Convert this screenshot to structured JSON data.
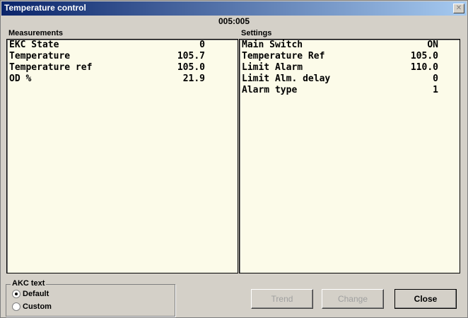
{
  "window": {
    "title": "Temperature control",
    "close_glyph": "✕"
  },
  "node_id": "005:005",
  "measurements": {
    "label": "Measurements",
    "rows": [
      {
        "name": "EKC State",
        "value": "0"
      },
      {
        "name": "Temperature",
        "value": "105.7"
      },
      {
        "name": "Temperature ref",
        "value": "105.0"
      },
      {
        "name": "OD %",
        "value": "21.9"
      }
    ]
  },
  "settings": {
    "label": "Settings",
    "rows": [
      {
        "name": "Main Switch",
        "value": "ON"
      },
      {
        "name": "Temperature Ref",
        "value": "105.0"
      },
      {
        "name": "Limit Alarm",
        "value": "110.0"
      },
      {
        "name": "Limit Alm. delay",
        "value": "0"
      },
      {
        "name": "Alarm type",
        "value": "1"
      }
    ]
  },
  "akc_text": {
    "label": "AKC text",
    "options": [
      {
        "label": "Default",
        "selected": true
      },
      {
        "label": "Custom",
        "selected": false
      }
    ]
  },
  "buttons": {
    "trend": "Trend",
    "change": "Change",
    "close": "Close"
  }
}
